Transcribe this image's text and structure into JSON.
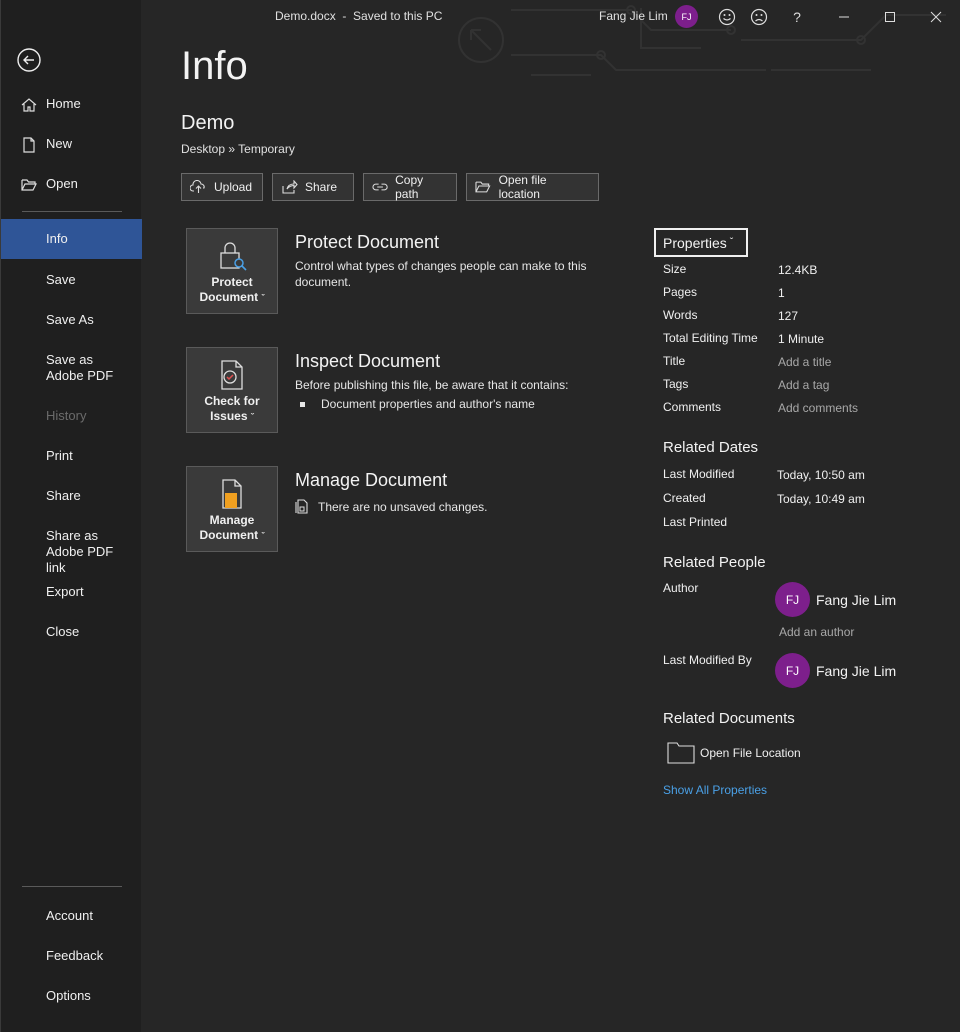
{
  "titlebar": {
    "doc_title": "Demo.docx  -  Saved to this PC",
    "user_name": "Fang Jie Lim",
    "user_initials": "FJ",
    "help": "?"
  },
  "sidebar": {
    "items": [
      {
        "label": "Home",
        "icon": "home-icon"
      },
      {
        "label": "New",
        "icon": "new-document-icon"
      },
      {
        "label": "Open",
        "icon": "folder-open-icon"
      },
      {
        "label": "Info"
      },
      {
        "label": "Save"
      },
      {
        "label": "Save As"
      },
      {
        "label": "Save as Adobe PDF"
      },
      {
        "label": "History"
      },
      {
        "label": "Print"
      },
      {
        "label": "Share"
      },
      {
        "label": "Share as Adobe PDF link"
      },
      {
        "label": "Export"
      },
      {
        "label": "Close"
      }
    ],
    "bottom": [
      {
        "label": "Account"
      },
      {
        "label": "Feedback"
      },
      {
        "label": "Options"
      }
    ]
  },
  "main": {
    "title": "Info",
    "doc_name": "Demo",
    "breadcrumb": "Desktop » Temporary",
    "actions": {
      "upload": "Upload",
      "share": "Share",
      "copy_path": "Copy path",
      "open_location": "Open file location"
    },
    "protect": {
      "button": "Protect Document",
      "title": "Protect Document",
      "desc": "Control what types of changes people can make to this document."
    },
    "inspect": {
      "button": "Check for Issues",
      "title": "Inspect Document",
      "desc": "Before publishing this file, be aware that it contains:",
      "bullet": "Document properties and author's name"
    },
    "manage": {
      "button": "Manage Document",
      "title": "Manage Document",
      "desc": "There are no unsaved changes."
    }
  },
  "properties": {
    "button": "Properties",
    "rows": [
      {
        "label": "Size",
        "value": "12.4KB"
      },
      {
        "label": "Pages",
        "value": "1"
      },
      {
        "label": "Words",
        "value": "127"
      },
      {
        "label": "Total Editing Time",
        "value": "1 Minute"
      },
      {
        "label": "Title",
        "value": "Add a title"
      },
      {
        "label": "Tags",
        "value": "Add a tag"
      },
      {
        "label": "Comments",
        "value": "Add comments"
      }
    ],
    "related_dates": {
      "heading": "Related Dates",
      "rows": [
        {
          "label": "Last Modified",
          "value": "Today, 10:50 am"
        },
        {
          "label": "Created",
          "value": "Today, 10:49 am"
        },
        {
          "label": "Last Printed",
          "value": ""
        }
      ]
    },
    "related_people": {
      "heading": "Related People",
      "author_label": "Author",
      "author_initials": "FJ",
      "author_name": "Fang Jie Lim",
      "add_author": "Add an author",
      "modified_label": "Last Modified By",
      "modified_initials": "FJ",
      "modified_name": "Fang Jie Lim"
    },
    "related_documents": {
      "heading": "Related Documents",
      "open_location": "Open File Location"
    },
    "show_all": "Show All Properties"
  },
  "colors": {
    "accent_nav": "#2f5597",
    "avatar": "#7d1f8c",
    "link": "#4aa0e6"
  }
}
